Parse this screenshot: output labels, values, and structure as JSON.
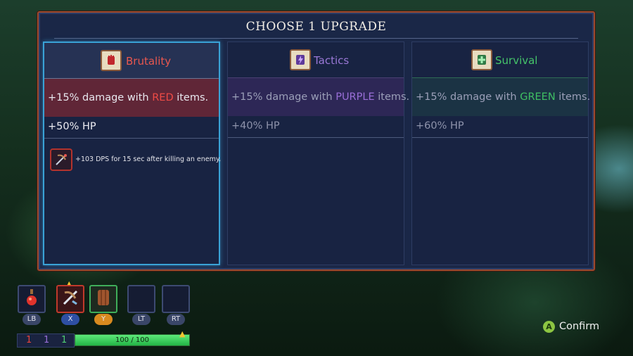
{
  "dialog": {
    "title": "CHOOSE 1 UPGRADE"
  },
  "options": [
    {
      "name": "Brutality",
      "icon": "brutality-fist-icon",
      "color": "#e8574f",
      "bonus_prefix": "+15% damage with ",
      "bonus_color_word": "RED",
      "bonus_suffix": " items.",
      "hp": "+50% HP",
      "perk_text": "+103 DPS for 15 sec after killing an enemy.",
      "perk_icon": "crossbow-perk-icon",
      "selected": true
    },
    {
      "name": "Tactics",
      "icon": "tactics-lightning-icon",
      "color": "#9a78d6",
      "bonus_prefix": "+15% damage with ",
      "bonus_color_word": "PURPLE",
      "bonus_suffix": " items.",
      "hp": "+40% HP",
      "selected": false
    },
    {
      "name": "Survival",
      "icon": "survival-cross-icon",
      "color": "#45c46a",
      "bonus_prefix": "+15% damage with ",
      "bonus_color_word": "GREEN",
      "bonus_suffix": " items.",
      "hp": "+60% HP",
      "selected": false
    }
  ],
  "hud": {
    "slots": [
      {
        "key": "LB",
        "icon": "health-flask-icon",
        "border": "#3d4a72"
      },
      {
        "key": "X",
        "icon": "crossbow-icon",
        "border": "#c0392b"
      },
      {
        "key": "Y",
        "icon": "wooden-shield-icon",
        "border": "#3fae5a"
      },
      {
        "key": "LT",
        "icon": "empty-slot",
        "border": "#3d4a72"
      },
      {
        "key": "RT",
        "icon": "empty-slot",
        "border": "#3d4a72"
      }
    ],
    "scroll_counts": {
      "red": "1",
      "purple": "1",
      "green": "1"
    },
    "health": {
      "text": "100 / 100",
      "fraction": 1.0
    }
  },
  "confirm": {
    "button": "A",
    "label": "Confirm"
  }
}
